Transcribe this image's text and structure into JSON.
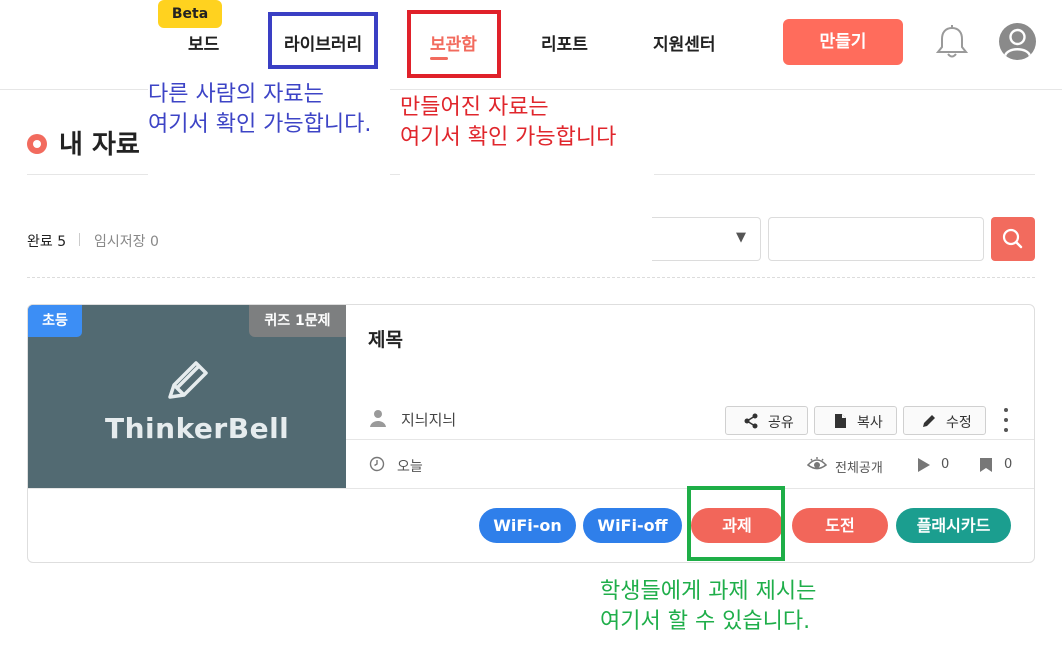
{
  "header": {
    "beta_badge": "Beta",
    "nav": {
      "board": "보드",
      "library": "라이브러리",
      "storage": "보관함",
      "report": "리포트",
      "support": "지원센터"
    },
    "create_button": "만들기",
    "icons": [
      "bell-icon",
      "avatar-icon"
    ]
  },
  "annotations": {
    "library_note": "다른 사람의 자료는\n여기서 확인 가능합니다.",
    "storage_note": "만들어진 자료는\n여기서 확인 가능합니다",
    "task_note": "학생들에게 과제 제시는\n여기서 할 수 있습니다."
  },
  "section": {
    "title": "내 자료",
    "tab_done": "완료 5",
    "tab_draft": "임시저장 0",
    "select_arrow": "▼",
    "search_placeholder": ""
  },
  "card": {
    "level_badge": "초등",
    "quiz_badge": "퀴즈 1문제",
    "logo_text": "ThinkerBell",
    "title": "제목",
    "author": "지늬지늬",
    "actions": {
      "share": "공유",
      "copy": "복사",
      "edit": "수정"
    },
    "date": "오늘",
    "visibility": "전체공개",
    "play_count": "0",
    "flag_count": "0",
    "buttons": {
      "wifi_on": "WiFi-on",
      "wifi_off": "WiFi-off",
      "task": "과제",
      "challenge": "도전",
      "flashcard": "플래시카드"
    }
  },
  "colors": {
    "accent": "#f26b5e",
    "create_button": "#ff6c5c",
    "wifi_blue": "#2f7fea",
    "flashcard_teal": "#1b9e8f",
    "annotation_blue": "#3d44c6",
    "annotation_red": "#e0262c",
    "annotation_green": "#1fae4a",
    "thumb_bg": "#526a72",
    "beta_yellow": "#ffd21f"
  }
}
